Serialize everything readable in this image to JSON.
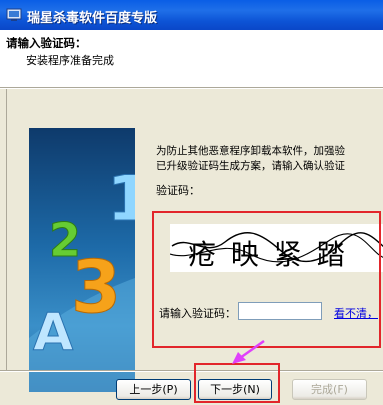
{
  "window": {
    "title": "瑞星杀毒软件百度专版"
  },
  "header": {
    "title": "请输入验证码：",
    "subtitle": "安装程序准备完成"
  },
  "banner": {
    "glyphs": [
      "1",
      "2",
      "3",
      "A"
    ]
  },
  "content": {
    "description_line1": "为防止其他恶意程序卸载本软件，加强验",
    "description_line2": "已升级验证码生成方案，请输入确认验证",
    "captcha_label": "验证码：",
    "captcha_text": "疮 映 紧 踏",
    "input_label": "请输入验证码：",
    "input_value": "",
    "cant_see_link": "看不清，"
  },
  "buttons": {
    "prev": "上一步(P)",
    "next": "下一步(N)",
    "finish": "完成(F)"
  },
  "colors": {
    "highlight_box": "#e2262b",
    "arrow": "#e040fb",
    "title_bar": "#0a5ee6"
  }
}
